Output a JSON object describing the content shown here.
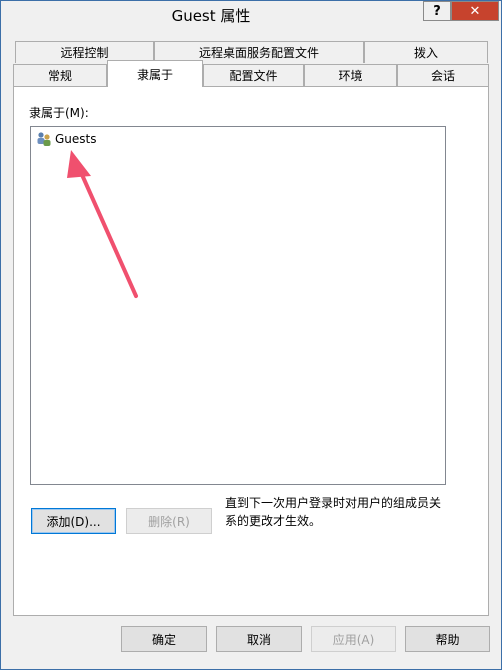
{
  "window": {
    "title": "Guest 属性",
    "help_label": "?",
    "close_label": "✕"
  },
  "tabs_row1": [
    {
      "label": "远程控制"
    },
    {
      "label": "远程桌面服务配置文件"
    },
    {
      "label": "拨入"
    }
  ],
  "tabs_row2": [
    {
      "label": "常规"
    },
    {
      "label": "隶属于",
      "active": true
    },
    {
      "label": "配置文件"
    },
    {
      "label": "环境"
    },
    {
      "label": "会话"
    }
  ],
  "member_of": {
    "label": "隶属于(M):",
    "items": [
      {
        "name": "Guests",
        "icon": "user-group-icon"
      }
    ]
  },
  "buttons": {
    "add": "添加(D)...",
    "remove": "删除(R)",
    "note": "直到下一次用户登录时对用户的组成员关系的更改才生效。"
  },
  "footer": {
    "ok": "确定",
    "cancel": "取消",
    "apply": "应用(A)",
    "help": "帮助"
  },
  "colors": {
    "close_button": "#c7432d",
    "annotation_arrow": "#f0506e",
    "focus_border": "#0078d7"
  }
}
